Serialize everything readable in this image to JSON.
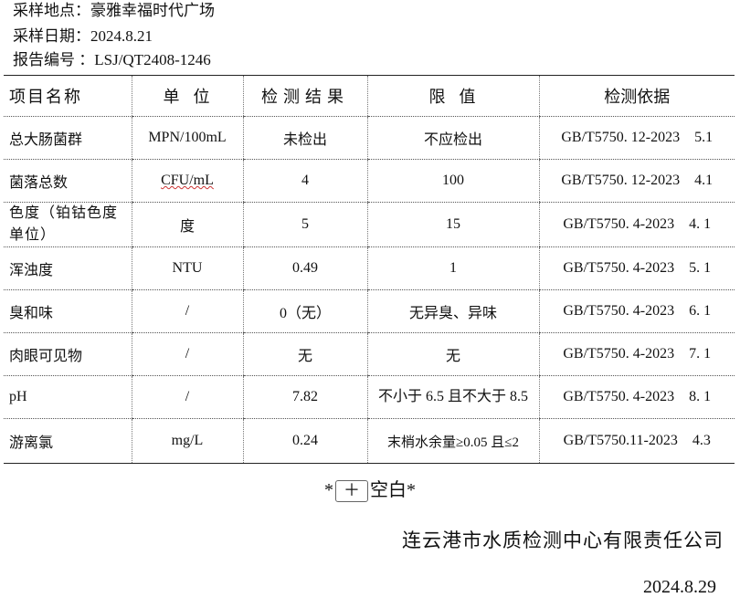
{
  "header": {
    "location": "采样地点：豪雅幸福时代广场",
    "date": "采样日期：2024.8.21",
    "report_no": "报告编号 ：LSJ/QT2408-1246"
  },
  "table": {
    "columns": [
      "项目名称",
      "单  位",
      "检测结果",
      "限  值",
      "检测依据"
    ],
    "rows": [
      {
        "item": "总大肠菌群",
        "unit": "MPN/100mL",
        "result": "未检出",
        "limit": "不应检出",
        "method": "GB/T5750. 12-2023    5.1"
      },
      {
        "item": "菌落总数",
        "unit": "CFU/mL",
        "result": "4",
        "limit": "100",
        "method": "GB/T5750. 12-2023    4.1"
      },
      {
        "item": "色度（铂钴色度单位）",
        "unit": "度",
        "result": "5",
        "limit": "15",
        "method": "GB/T5750. 4-2023    4. 1"
      },
      {
        "item": "浑浊度",
        "unit": "NTU",
        "result": "0.49",
        "limit": "1",
        "method": "GB/T5750. 4-2023    5. 1"
      },
      {
        "item": "臭和味",
        "unit": "/",
        "result": "0（无）",
        "limit": "无异臭、异味",
        "method": "GB/T5750. 4-2023    6. 1"
      },
      {
        "item": "肉眼可见物",
        "unit": "/",
        "result": "无",
        "limit": "无",
        "method": "GB/T5750. 4-2023    7. 1"
      },
      {
        "item": "pH",
        "unit": "/",
        "result": "7.82",
        "limit": "不小于 6.5 且不大于 8.5",
        "method": "GB/T5750. 4-2023    8. 1"
      },
      {
        "item": "游离氯",
        "unit": "mg/L",
        "result": "0.24",
        "limit": "末梢水余量≥0.05 且≤2",
        "method": "GB/T5750.11-2023    4.3"
      }
    ]
  },
  "footer": {
    "blank_left": "*",
    "plus": "＋",
    "blank_right": "空白*",
    "company": "连云港市水质检测中心有限责任公司",
    "date": "2024.8.29"
  }
}
